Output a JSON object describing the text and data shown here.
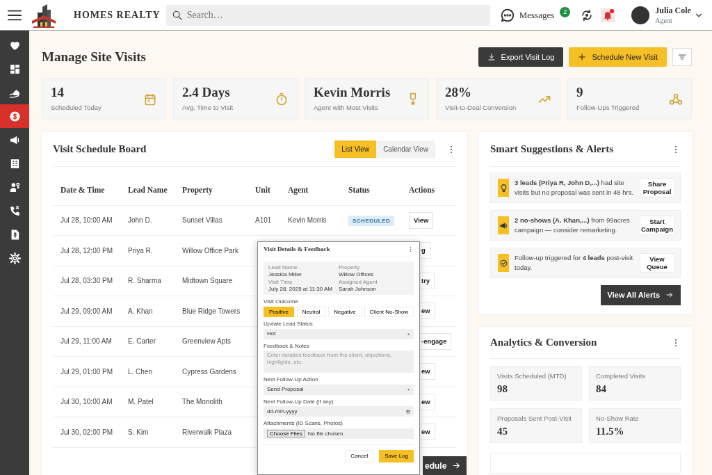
{
  "topbar": {
    "brand": "HOMES REALTY",
    "search": {
      "placeholder": "Search…"
    },
    "messages": {
      "label": "Messages",
      "count": "2"
    },
    "notifications": {
      "unread": true
    },
    "user": {
      "name": "Julia Cole",
      "role": "Agent"
    }
  },
  "sidebar": {
    "items": [
      {
        "selected": false
      },
      {
        "selected": false
      },
      {
        "selected": false
      },
      {
        "selected": true
      },
      {
        "selected": false
      },
      {
        "selected": false
      },
      {
        "selected": false
      },
      {
        "selected": false
      },
      {
        "selected": false
      },
      {
        "selected": false
      }
    ]
  },
  "page": {
    "title": "Manage Site Visits",
    "actions": [
      {
        "label": "Export Visit Log",
        "kind": "dark"
      },
      {
        "label": "Schedule New Visit",
        "kind": "primary"
      }
    ]
  },
  "stats": [
    {
      "value": "14",
      "label": "Scheduled Today"
    },
    {
      "value": "2.4 Days",
      "label": "Avg. Time to Visit"
    },
    {
      "value": "Kevin Morris",
      "label": "Agent with Most Visits"
    },
    {
      "value": "28%",
      "label": "Visit-to-Deal Conversion"
    },
    {
      "value": "9",
      "label": "Follow-Ups Triggered"
    }
  ],
  "schedule": {
    "title": "Visit Schedule Board",
    "views": [
      {
        "label": "List View",
        "selected": true
      },
      {
        "label": "Calendar View",
        "selected": false
      }
    ],
    "columns": [
      "Date & Time",
      "Lead Name",
      "Property",
      "Unit",
      "Agent",
      "Status",
      "Actions"
    ],
    "rows": [
      {
        "date": "Jul 28, 10:00 AM",
        "lead": "John D.",
        "property": "Sunset Villas",
        "unit": "A101",
        "agent": "Kevin Morris",
        "status": "SCHEDULED",
        "action": "View"
      },
      {
        "date": "Jul 28, 12:00 PM",
        "lead": "Priya R.",
        "property": "Willow Office Park",
        "action": "g"
      },
      {
        "date": "Jul 28, 03:30 PM",
        "lead": "R. Sharma",
        "property": "Midtown Square",
        "action": "try"
      },
      {
        "date": "Jul 29, 09:00 AM",
        "lead": "A. Khan",
        "property": "Blue Ridge Towers",
        "action": "ew"
      },
      {
        "date": "Jul 29, 11:00 AM",
        "lead": "E. Carter",
        "property": "Greenview Apts",
        "action": "-engage"
      },
      {
        "date": "Jul 29, 01:00 PM",
        "lead": "L. Chen",
        "property": "Cypress Gardens",
        "action": "ew"
      },
      {
        "date": "Jul 30, 10:00 AM",
        "lead": "M. Patel",
        "property": "The Monolith",
        "action": "ew"
      },
      {
        "date": "Jul 30, 02:00 PM",
        "lead": "S. Kim",
        "property": "Riverwalk Plaza",
        "action": "ew"
      }
    ],
    "footer_button": "edule"
  },
  "modal": {
    "title": "Visit Details & Feedback",
    "info": [
      {
        "label": "Lead Name",
        "value": "Jessica Miller"
      },
      {
        "label": "Property",
        "value": "Willow Offices"
      },
      {
        "label": "Visit Time",
        "value": "July 28, 2025 at 11:30 AM"
      },
      {
        "label": "Assigned Agent",
        "value": "Sarah Johnson"
      }
    ],
    "outcome": {
      "label": "Visit Outcome",
      "options": [
        {
          "label": "Positive",
          "selected": true
        },
        {
          "label": "Neutral",
          "selected": false
        },
        {
          "label": "Negative",
          "selected": false
        },
        {
          "label": "Client No-Show",
          "selected": false
        }
      ]
    },
    "lead_status": {
      "label": "Update Lead Status",
      "value": "Hot"
    },
    "feedback": {
      "label": "Feedback & Notes",
      "placeholder": "Enter detailed feedback from the client, objections, highlights, etc."
    },
    "next_action": {
      "label": "Next Follow-Up Action",
      "value": "Send Proposal"
    },
    "next_date": {
      "label": "Next Follow-Up Date (if any)",
      "value": "dd-mm-yyyy"
    },
    "attachments": {
      "label": "Attachments (ID Scans, Photos)",
      "button": "Choose Files",
      "value": "No file chosen"
    },
    "buttons": [
      {
        "label": "Cancel",
        "kind": "light"
      },
      {
        "label": "Save Log",
        "kind": "primary"
      }
    ]
  },
  "alerts": {
    "title": "Smart Suggestions & Alerts",
    "items": [
      {
        "text": "**3 leads (Priya R, John D,...)** had site visits but no proposal was sent in 48 hrs.",
        "action": "Share Proposal"
      },
      {
        "text": "**2 no-shows (A. Khan,...)** from 99acres campaign — consider remarketing.",
        "action": "Start Campaign"
      },
      {
        "text": "Follow-up triggered for **4 leads** post-visit today.",
        "action": "View Queue"
      }
    ],
    "button": "View All Alerts"
  },
  "analytics": {
    "title": "Analytics & Conversion",
    "metrics": [
      {
        "label": "Visits Scheduled (MTD)",
        "value": "98"
      },
      {
        "label": "Completed Visits",
        "value": "84"
      },
      {
        "label": "Proposals Sent Post-Visit",
        "value": "45"
      },
      {
        "label": "No-Show Rate",
        "value": "11.5%"
      }
    ]
  }
}
